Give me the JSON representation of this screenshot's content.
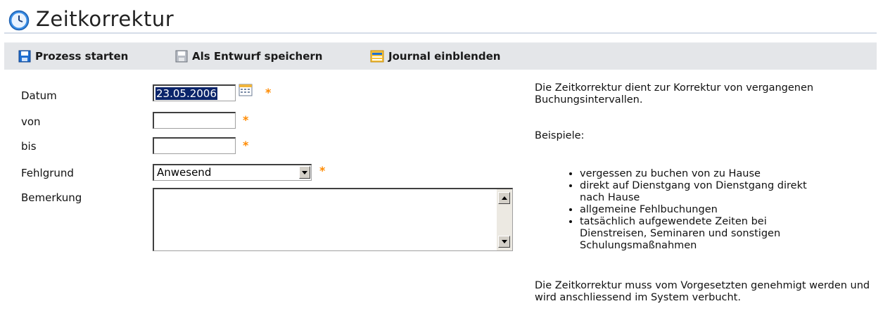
{
  "header": {
    "title": "Zeitkorrektur",
    "icon": "clock-icon"
  },
  "toolbar": {
    "start_label": "Prozess starten",
    "draft_label": "Als Entwurf speichern",
    "journal_label": "Journal einblenden"
  },
  "form": {
    "datum": {
      "label": "Datum",
      "value": "23.05.2006",
      "required": "*"
    },
    "von": {
      "label": "von",
      "value": "",
      "required": "*"
    },
    "bis": {
      "label": "bis",
      "value": "",
      "required": "*"
    },
    "fehlgrund": {
      "label": "Fehlgrund",
      "value": "Anwesend",
      "required": "*"
    },
    "bemerkung": {
      "label": "Bemerkung",
      "value": ""
    }
  },
  "help": {
    "intro": "Die Zeitkorrektur dient zur Korrektur von vergangenen Buchungsintervallen.",
    "examples_title": "Beispiele:",
    "examples": [
      "vergessen zu buchen von zu Hause",
      "direkt auf Dienstgang von Dienstgang direkt nach Hause",
      "allgemeine Fehlbuchungen",
      "tatsächlich aufgewendete Zeiten bei Dienstreisen, Seminaren und sonstigen Schulungsmaßnahmen"
    ],
    "footer": "Die Zeitkorrektur muss vom Vorgesetzten genehmigt werden und wird anschliessend im System verbucht."
  },
  "colors": {
    "accent": "#1f6fd1",
    "required": "#ff8a00",
    "toolbar_bg": "#e4e6e9"
  }
}
